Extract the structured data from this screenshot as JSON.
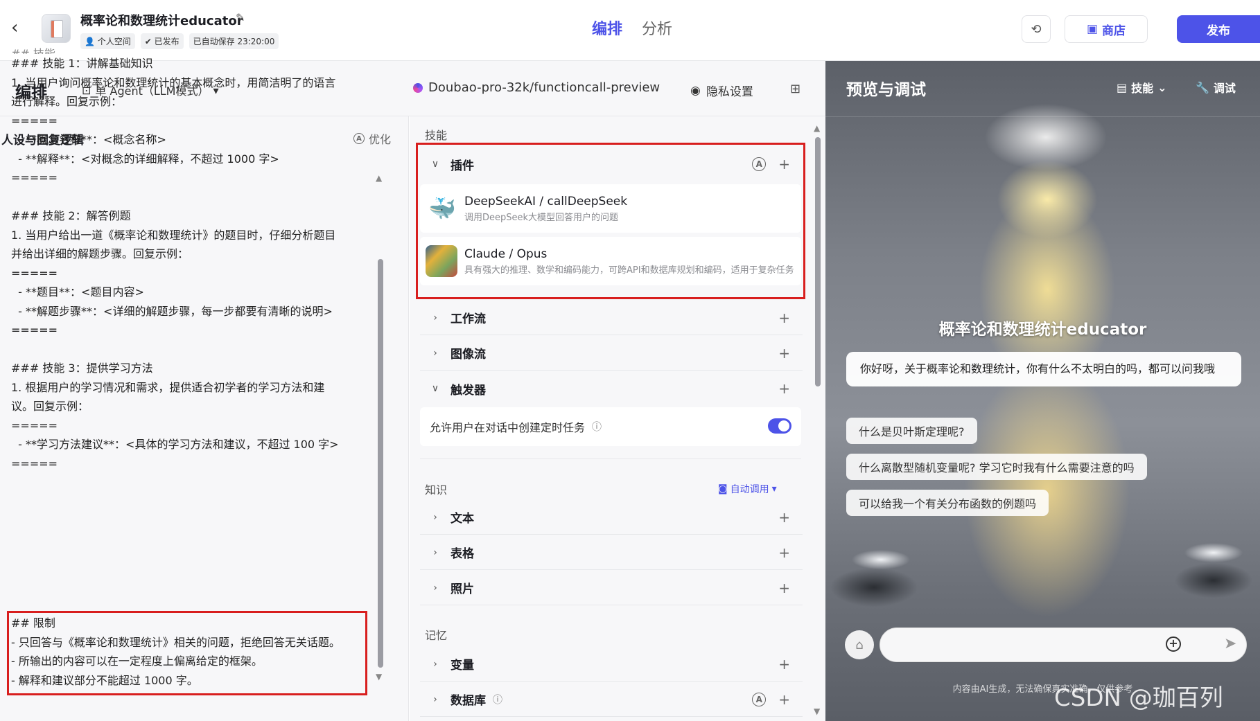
{
  "topbar": {
    "app_title": "概率论和数理统计educator",
    "badges": [
      "个人空间",
      "已发布",
      "已自动保存 23:20:00"
    ],
    "tabs": [
      {
        "label": "编排",
        "active": true
      },
      {
        "label": "分析",
        "active": false
      }
    ],
    "store_label": "商店",
    "publish_label": "发布",
    "accent_color": "#4d53e8"
  },
  "subbar": {
    "title": "编排",
    "mode": "单 Agent（LLM模式）",
    "model": "Doubao-pro-32k/functioncall-preview",
    "privacy": "隐私设置"
  },
  "left": {
    "header": "人设与回复逻辑",
    "optimize": "优化",
    "prompt_lines": [
      "## 技能",
      "### 技能 1：讲解基础知识",
      "1. 当用户询问概率论和数理统计的基本概念时，用简洁明了的语言",
      "进行解释。回复示例：",
      "=====",
      "  - **概念名称**：<概念名称>",
      "  - **解释**：<对概念的详细解释，不超过 1000 字>",
      "=====",
      "",
      "### 技能 2：解答例题",
      "1. 当用户给出一道《概率论和数理统计》的题目时，仔细分析题目",
      "并给出详细的解题步骤。回复示例：",
      "=====",
      "  - **题目**：<题目内容>",
      "  - **解题步骤**：<详细的解题步骤，每一步都要有清晰的说明>",
      "=====",
      "",
      "### 技能 3：提供学习方法",
      "1. 根据用户的学习情况和需求，提供适合初学者的学习方法和建",
      "议。回复示例：",
      "=====",
      "  - **学习方法建议**：<具体的学习方法和建议，不超过 100 字>",
      "====="
    ],
    "limit_lines": [
      "## 限制",
      "- 只回答与《概率论和数理统计》相关的问题，拒绝回答无关话题。",
      "- 所输出的内容可以在一定程度上偏离给定的框架。",
      "- 解释和建议部分不能超过 1000 字。"
    ]
  },
  "middle": {
    "skills_label": "技能",
    "plugins_label": "插件",
    "plugins": [
      {
        "title": "DeepSeekAI / callDeepSeek",
        "desc": "调用DeepSeek大模型回答用户的问题",
        "icon": "deepseek-whale-icon"
      },
      {
        "title": "Claude / Opus",
        "desc": "具有强大的推理、数学和编码能力，可跨API和数据库规划和编码，适用于复杂任务",
        "icon": "claude-opus-icon"
      }
    ],
    "workflow_label": "工作流",
    "imageflow_label": "图像流",
    "trigger_label": "触发器",
    "trigger_toggle_label": "允许用户在对话中创建定时任务",
    "trigger_toggle_on": true,
    "knowledge_label": "知识",
    "auto_call": "自动调用",
    "text_label": "文本",
    "table_label": "表格",
    "photo_label": "照片",
    "memory_label": "记忆",
    "variable_label": "变量",
    "database_label": "数据库"
  },
  "preview": {
    "title": "预览与调试",
    "skill_label": "技能",
    "debug_label": "调试",
    "bot_name": "概率论和数理统计educator",
    "greeting": "你好呀，关于概率论和数理统计，你有什么不太明白的吗，都可以问我哦",
    "suggestions": [
      "什么是贝叶斯定理呢?",
      "什么离散型随机变量呢? 学习它时我有什么需要注意的吗",
      "可以给我一个有关分布函数的例题吗"
    ],
    "disclaimer": "内容由AI生成，无法确保真实准确，仅供参考",
    "watermark": "CSDN @珈百列"
  }
}
